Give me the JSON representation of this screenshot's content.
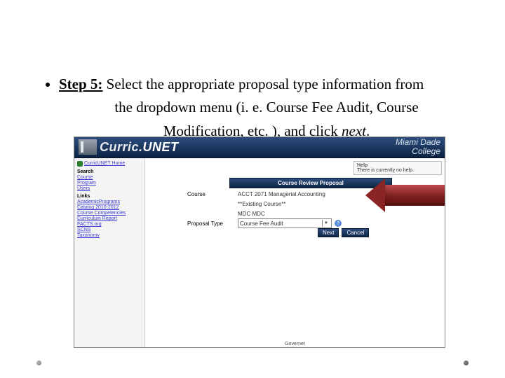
{
  "instruction": {
    "step_label": "Step 5:",
    "line1_rest": " Select the appropriate proposal type information from",
    "line2": "the dropdown menu (i. e. Course Fee Audit, Course",
    "line3_plain": "Modification, etc. ), and click ",
    "line3_em": "next",
    "line3_end": "."
  },
  "app": {
    "logo_curric": "Curric.",
    "logo_unet": "UNET",
    "brand_line1": "Miami Dade",
    "brand_line2": "College"
  },
  "sidebar": {
    "home": "CurricUNET Home",
    "search_hdr": "Search",
    "search_items": [
      "Course",
      "Program",
      "Users"
    ],
    "links_hdr": "Links",
    "link_items": [
      "AcademicPrograms",
      "Catalog 2010-2012",
      "Course Competencies",
      "Curriculum Report",
      "FACTS.org",
      "SCNS",
      "Taxonomy"
    ]
  },
  "help": {
    "title": "Help",
    "body": "There is currently no help."
  },
  "form": {
    "review_title": "Course Review Proposal",
    "course_label": "Course",
    "course_value": "ACCT 2071 Managerial Accounting",
    "existing": "**Existing Course**",
    "college": "MDC MDC",
    "proposal_type_label": "Proposal Type",
    "proposal_type_value": "Course Fee Audit",
    "next_btn": "Next",
    "cancel_btn": "Cancel"
  },
  "bottom_text": "Governet"
}
